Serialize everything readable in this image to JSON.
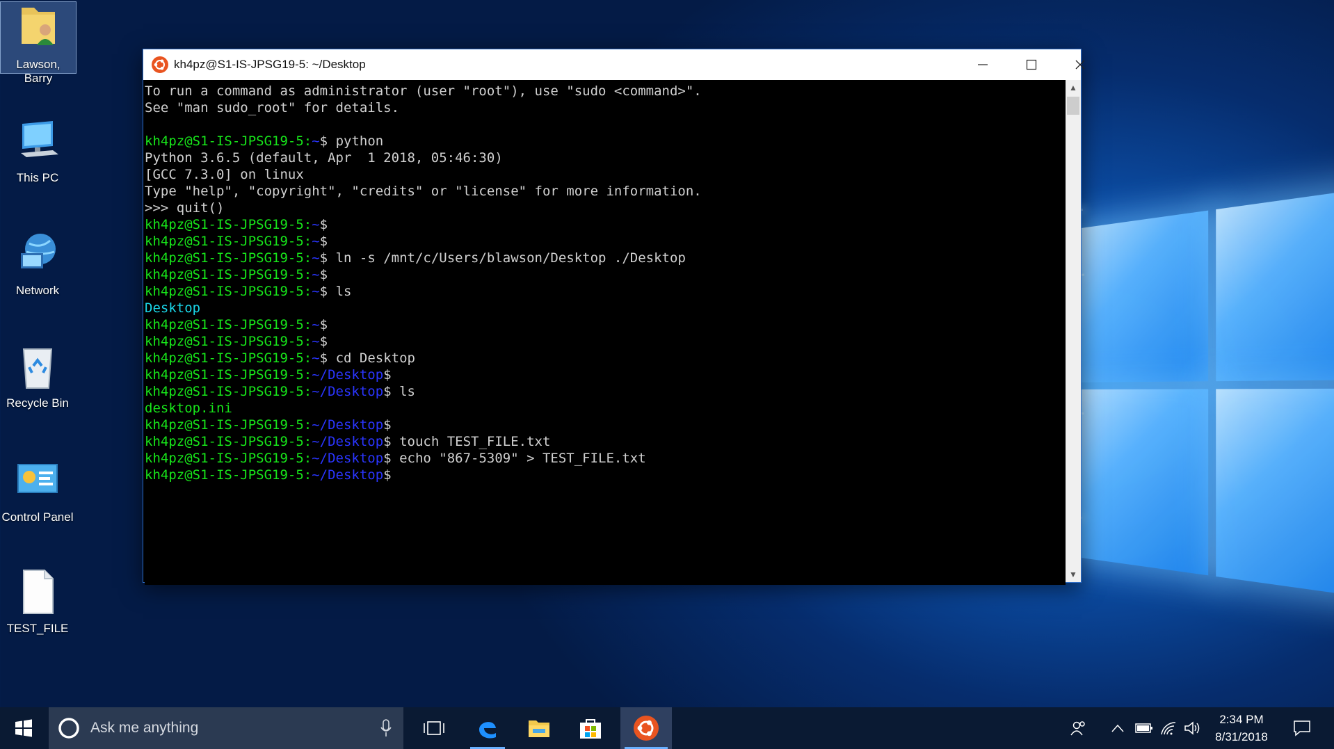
{
  "desktop": {
    "icons": [
      {
        "label": "Lawson, Barry"
      },
      {
        "label": "This PC"
      },
      {
        "label": "Network"
      },
      {
        "label": "Recycle Bin"
      },
      {
        "label": "Control Panel"
      },
      {
        "label": "TEST_FILE"
      }
    ]
  },
  "terminal": {
    "title": "kh4pz@S1-IS-JPSG19-5: ~/Desktop",
    "prompt_user": "kh4pz@S1-IS-JPSG19-5:",
    "lines": [
      {
        "kind": "text",
        "text": "To run a command as administrator (user \"root\"), use \"sudo <command>\"."
      },
      {
        "kind": "text",
        "text": "See \"man sudo_root\" for details."
      },
      {
        "kind": "blank",
        "text": ""
      },
      {
        "kind": "prompt",
        "path": "~",
        "cmd": " python"
      },
      {
        "kind": "text",
        "text": "Python 3.6.5 (default, Apr  1 2018, 05:46:30)"
      },
      {
        "kind": "text",
        "text": "[GCC 7.3.0] on linux"
      },
      {
        "kind": "text",
        "text": "Type \"help\", \"copyright\", \"credits\" or \"license\" for more information."
      },
      {
        "kind": "text",
        "text": ">>> quit()"
      },
      {
        "kind": "prompt",
        "path": "~",
        "cmd": ""
      },
      {
        "kind": "prompt",
        "path": "~",
        "cmd": ""
      },
      {
        "kind": "prompt",
        "path": "~",
        "cmd": " ln -s /mnt/c/Users/blawson/Desktop ./Desktop"
      },
      {
        "kind": "prompt",
        "path": "~",
        "cmd": ""
      },
      {
        "kind": "prompt",
        "path": "~",
        "cmd": " ls"
      },
      {
        "kind": "dir",
        "text": "Desktop"
      },
      {
        "kind": "prompt",
        "path": "~",
        "cmd": ""
      },
      {
        "kind": "prompt",
        "path": "~",
        "cmd": ""
      },
      {
        "kind": "prompt",
        "path": "~",
        "cmd": " cd Desktop"
      },
      {
        "kind": "prompt",
        "path": "~/Desktop",
        "cmd": ""
      },
      {
        "kind": "prompt",
        "path": "~/Desktop",
        "cmd": " ls"
      },
      {
        "kind": "file",
        "text": "desktop.ini"
      },
      {
        "kind": "prompt",
        "path": "~/Desktop",
        "cmd": ""
      },
      {
        "kind": "prompt",
        "path": "~/Desktop",
        "cmd": " touch TEST_FILE.txt"
      },
      {
        "kind": "prompt",
        "path": "~/Desktop",
        "cmd": " echo \"867-5309\" > TEST_FILE.txt"
      },
      {
        "kind": "prompt",
        "path": "~/Desktop",
        "cmd": ""
      }
    ]
  },
  "taskbar": {
    "search_placeholder": "Ask me anything",
    "clock_time": "2:34 PM",
    "clock_date": "8/31/2018"
  },
  "colors": {
    "prompt_green": "#17e61a",
    "path_blue": "#2a35ff",
    "dir_cyan": "#1ad6e9"
  }
}
